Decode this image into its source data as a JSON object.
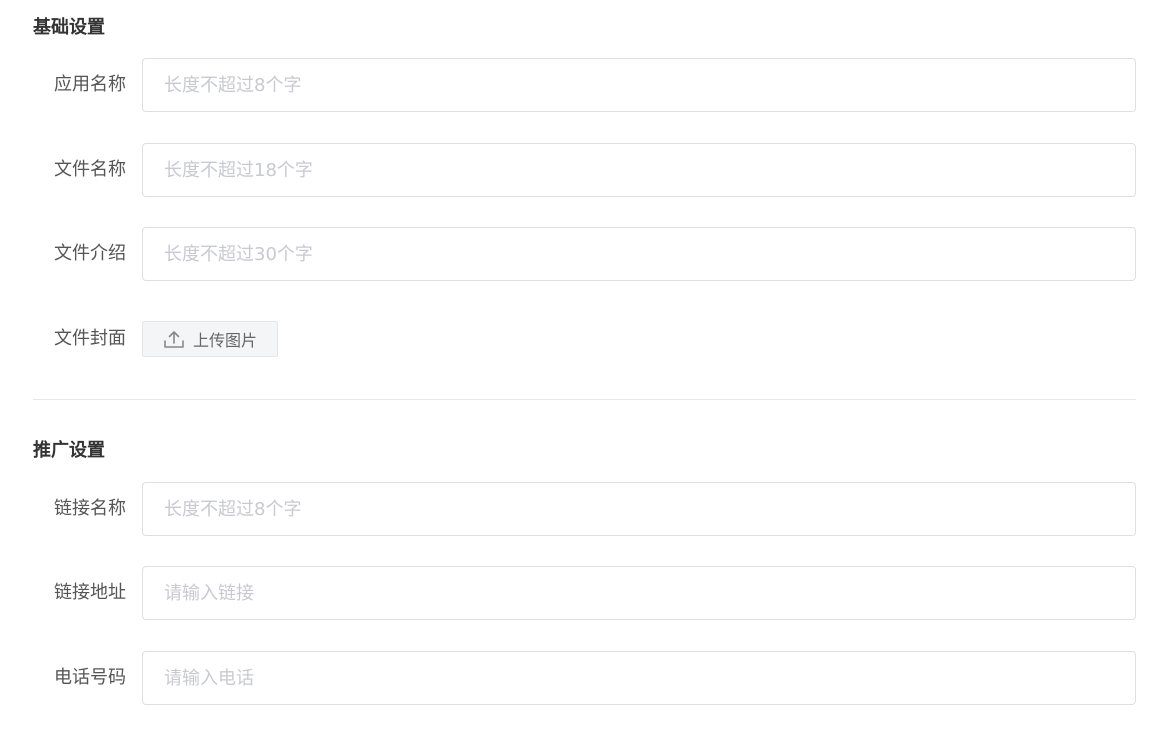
{
  "basic_section": {
    "title": "基础设置",
    "fields": [
      {
        "label": "应用名称",
        "placeholder": "长度不超过8个字",
        "value": ""
      },
      {
        "label": "文件名称",
        "placeholder": "长度不超过18个字",
        "value": ""
      },
      {
        "label": "文件介绍",
        "placeholder": "长度不超过30个字",
        "value": ""
      }
    ],
    "cover": {
      "label": "文件封面",
      "upload_label": "上传图片",
      "upload_icon": "upload-icon"
    }
  },
  "promo_section": {
    "title": "推广设置",
    "fields": [
      {
        "label": "链接名称",
        "placeholder": "长度不超过8个字",
        "value": ""
      },
      {
        "label": "链接地址",
        "placeholder": "请输入链接",
        "value": ""
      },
      {
        "label": "电话号码",
        "placeholder": "请输入电话",
        "value": ""
      }
    ]
  },
  "colors": {
    "border": "#dcdfe6",
    "placeholder": "#c8cad0",
    "label": "#555555",
    "title": "#333333",
    "upload_bg": "#f4f5f6"
  }
}
